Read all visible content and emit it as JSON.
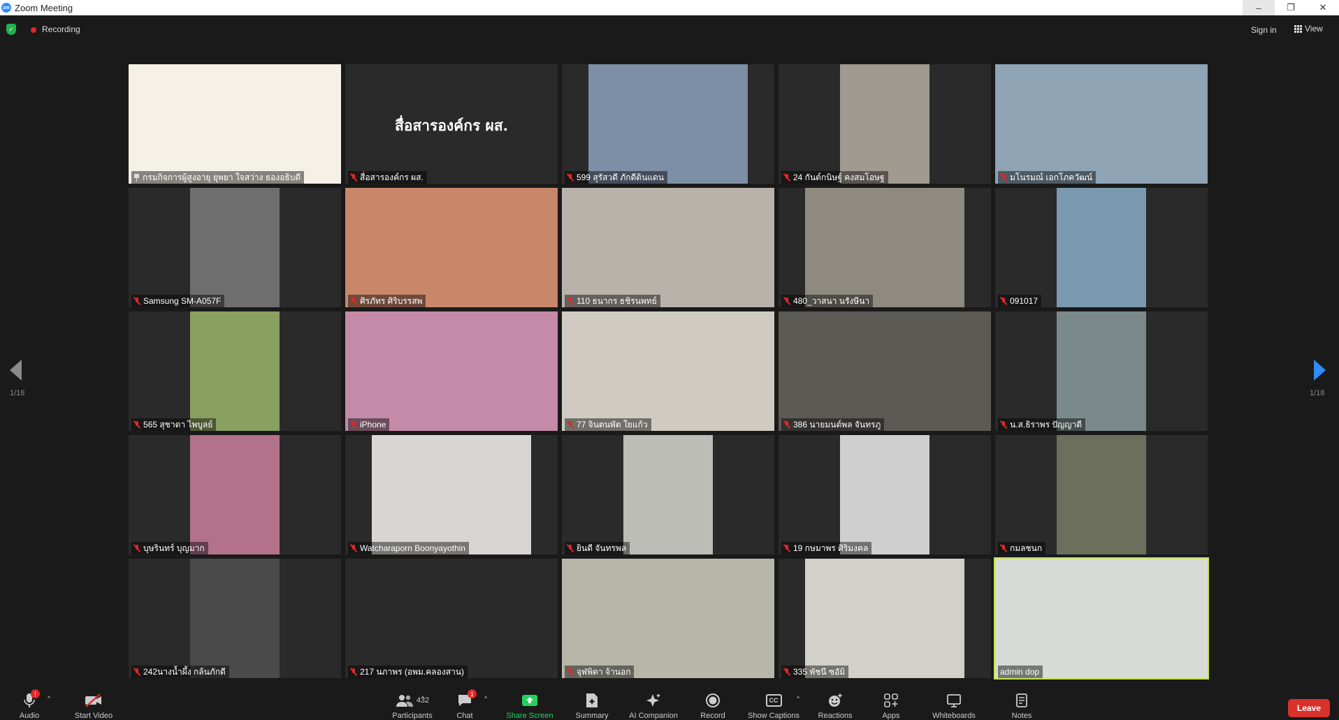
{
  "window": {
    "logo_text": "zm",
    "title": "Zoom Meeting",
    "minimize": "–",
    "maximize": "❐",
    "close": "✕"
  },
  "topbar": {
    "security_icon": "shield-check-icon",
    "recording_label": "Recording",
    "sign_in": "Sign in",
    "view_label": "View"
  },
  "pagination": {
    "left_page": "1/18",
    "right_page": "1/18"
  },
  "org_text": "สื่อสารองค์กร ผส.",
  "tiles": [
    {
      "name": "กรมกิจการผู้สูงอายุ ยุพยา ใจสว่าง ธองอธิบดี",
      "icon": "pin",
      "bg": "#f5f1e6",
      "vbg": "#f5f1e6"
    },
    {
      "name": "สื่อสารองค์กร ผส.",
      "icon": "mute",
      "bg": "#2a2a2a",
      "vbg": "#2a2a2a"
    },
    {
      "name": "599 สุรัสวดี ภักดีดินแดน",
      "icon": "mute",
      "bg": "#2a2a2a",
      "vbg": "#7d8fa6"
    },
    {
      "name": "24 กันต์กนิษฐ์ คงสมโอษฐ",
      "icon": "mute",
      "bg": "#2a2a2a",
      "vbg": "#a09a90"
    },
    {
      "name": "มโนรมณ์ เอกโภควัฒน์",
      "icon": "mute",
      "bg": "#8fa4b5",
      "vbg": "#8fa4b5"
    },
    {
      "name": "Samsung SM-A057F",
      "icon": "mute",
      "bg": "#2a2a2a",
      "vbg": "#6e6e6e"
    },
    {
      "name": "ศิรภัทร ศิริบรรสพ",
      "icon": "mute",
      "bg": "#c9876a",
      "vbg": "#c9876a"
    },
    {
      "name": "110 ธนากร ธชิรนพทย์",
      "icon": "mute",
      "bg": "#b8b2ab",
      "vbg": "#b8b2ab"
    },
    {
      "name": "480_วาสนา นรังษีนา",
      "icon": "mute",
      "bg": "#2a2a2a",
      "vbg": "#8f8a80"
    },
    {
      "name": "091017",
      "icon": "mute",
      "bg": "#2a2a2a",
      "vbg": "#7b9ab0"
    },
    {
      "name": "565 สุชาดา ไพบูลย์",
      "icon": "mute",
      "bg": "#2a2a2a",
      "vbg": "#8aa060"
    },
    {
      "name": "iPhone",
      "icon": "mute",
      "bg": "#c48aa8",
      "vbg": "#c48aa8"
    },
    {
      "name": "77 จินตนพัต  ใยแก้ว",
      "icon": "mute",
      "bg": "#cfcac2",
      "vbg": "#cfcac2"
    },
    {
      "name": "386 นายมนต์พล จันทรภู",
      "icon": "mute",
      "bg": "#5b5a55",
      "vbg": "#5b5a55"
    },
    {
      "name": "น.ส.ธิราพร ปัญญาดี",
      "icon": "mute",
      "bg": "#2a2a2a",
      "vbg": "#7a8a8a"
    },
    {
      "name": "บุษรินทร์ บุญมาก",
      "icon": "mute",
      "bg": "#2a2a2a",
      "vbg": "#b2738a"
    },
    {
      "name": "Watcharaporn Boonyayothin",
      "icon": "mute",
      "bg": "#2a2a2a",
      "vbg": "#d8d6d2"
    },
    {
      "name": "ยินดี จันทรพล",
      "icon": "mute",
      "bg": "#2a2a2a",
      "vbg": "#bdbdb8"
    },
    {
      "name": "19 กษมาพร ศิริมงคล",
      "icon": "mute",
      "bg": "#2a2a2a",
      "vbg": "#cfcfd0"
    },
    {
      "name": "กมลชนก",
      "icon": "mute",
      "bg": "#2a2a2a",
      "vbg": "#6b6f5c"
    },
    {
      "name": "242นางน้ำผึ้ง  กล้นภักดี",
      "icon": "mute",
      "bg": "#2a2a2a",
      "vbg": "#4a4a4a"
    },
    {
      "name": "217 นภาพร (อพม.คลองสาน)",
      "icon": "mute",
      "bg": "#2a2a2a",
      "vbg": "#2a2a2a"
    },
    {
      "name": "จุฬพิตา จ้านอก",
      "icon": "mute",
      "bg": "#b8b6a8",
      "vbg": "#b8b6a8"
    },
    {
      "name": "335  พัชนี  ซอัมิ",
      "icon": "mute",
      "bg": "#2a2a2a",
      "vbg": "#d2d0c8"
    },
    {
      "name": "admin dop",
      "icon": "none",
      "bg": "#d8dad8",
      "vbg": "#d8dad8",
      "active": true
    }
  ],
  "toolbar": {
    "audio": "Audio",
    "audio_badge": "!",
    "start_video": "Start Video",
    "participants": "Participants",
    "participants_count": "432",
    "chat": "Chat",
    "chat_badge": "1",
    "share_screen": "Share Screen",
    "summary": "Summary",
    "ai_companion": "AI Companion",
    "record": "Record",
    "show_captions": "Show Captions",
    "cc_text": "CC",
    "reactions": "Reactions",
    "apps": "Apps",
    "whiteboards": "Whiteboards",
    "notes": "Notes",
    "leave": "Leave"
  },
  "colors": {
    "accent_blue": "#2d8cff",
    "share_green": "#23d160",
    "leave_red": "#d9312b",
    "mute_red": "#e02828",
    "active_speaker": "#c3e54a"
  }
}
